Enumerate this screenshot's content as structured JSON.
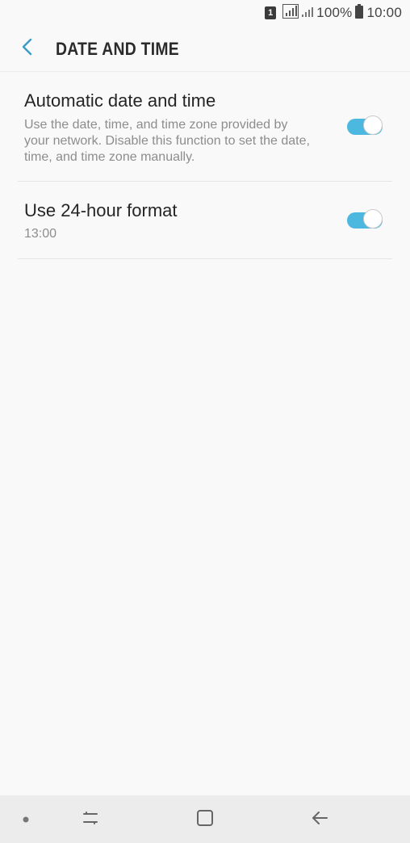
{
  "status_bar": {
    "sim_label": "1",
    "battery": "100%",
    "time": "10:00",
    "icons": [
      "sim-card-icon",
      "signal-icon",
      "signal-weak-icon",
      "battery-icon"
    ]
  },
  "header": {
    "title": "DATE AND TIME",
    "back_icon": "chevron-left-icon",
    "accent_color": "#3a9bc6"
  },
  "settings": [
    {
      "title": "Automatic date and time",
      "description": "Use the date, time, and time zone provided by your network. Disable this function to set the date, time, and time zone manually.",
      "toggle_on": true
    },
    {
      "title": "Use 24-hour format",
      "subtitle": "13:00",
      "toggle_on": true
    }
  ],
  "toggle_on_color": "#4cb8e0",
  "nav_bar": {
    "icons": [
      "dot-icon",
      "recents-icon",
      "home-icon",
      "back-arrow-icon"
    ]
  }
}
